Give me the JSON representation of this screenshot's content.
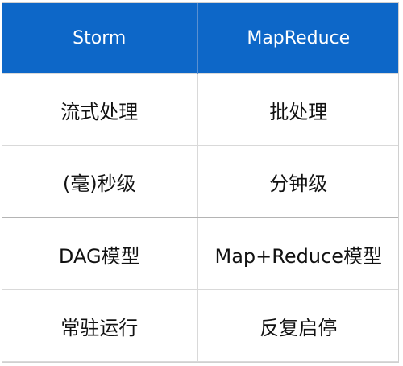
{
  "table": {
    "headers": [
      "Storm",
      "MapReduce"
    ],
    "rows": [
      [
        "流式处理",
        "批处理"
      ],
      [
        "(毫)秒级",
        "分钟级"
      ],
      [
        "DAG模型",
        "Map+Reduce模型"
      ],
      [
        "常驻运行",
        "反复启停"
      ]
    ]
  },
  "colors": {
    "header_background": "#0d67c8",
    "header_text": "#ffffff",
    "body_text": "#111111",
    "grid_line": "#d9d9d9"
  }
}
